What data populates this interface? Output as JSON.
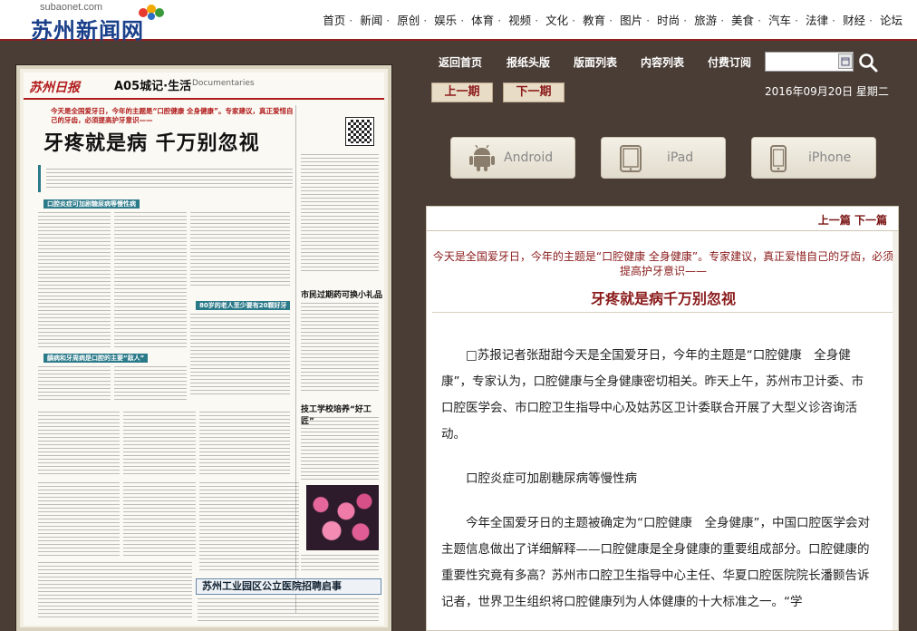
{
  "site": {
    "logo_domain": "subaonet.com",
    "logo_name": "苏州新闻网",
    "nav": [
      "首页",
      "新闻",
      "原创",
      "娱乐",
      "体育",
      "视频",
      "文化",
      "教育",
      "图片",
      "时尚",
      "旅游",
      "美食",
      "汽车",
      "法律",
      "财经",
      "论坛"
    ]
  },
  "epaper": {
    "links": [
      "返回首页",
      "报纸头版",
      "版面列表",
      "内容列表",
      "付费订阅"
    ],
    "prev_page": "上一期",
    "next_page": "下一期",
    "date": "2016年09月20日",
    "weekday": "星期二",
    "apps": [
      "Android",
      "iPad",
      "iPhone"
    ]
  },
  "newspaper_page": {
    "brand": "苏州日报",
    "section": "A05城记·生活",
    "section_en": "Documentaries",
    "lead": "今天是全国爱牙日，今年的主题是“口腔健康 全身健康”。专家建议，真正爱惜自己的牙齿，必须提高护牙意识——",
    "headline": "牙疼就是病 千万别忽视",
    "subheads": [
      "口腔炎症可加剧糖尿病等慢性病",
      "龋病和牙周病是口腔的主要“敌人”",
      "80岁的老人至少要有20颗好牙",
      "市民过期药可换小礼品",
      "技工学校培养“好工匠”"
    ],
    "ad_title": "苏州工业园区公立医院招聘启事"
  },
  "article": {
    "prev": "上一篇",
    "next": "下一篇",
    "lead": "今天是全国爱牙日，今年的主题是“口腔健康 全身健康”。专家建议，真正爱惜自己的牙齿，必须提高护牙意识——",
    "title": "牙疼就是病千万别忽视",
    "paragraphs": [
      "□苏报记者张甜甜今天是全国爱牙日，今年的主题是“口腔健康　全身健康”，专家认为，口腔健康与全身健康密切相关。昨天上午，苏州市卫计委、市口腔医学会、市口腔卫生指导中心及姑苏区卫计委联合开展了大型义诊咨询活动。",
      "口腔炎症可加剧糖尿病等慢性病",
      "今年全国爱牙日的主题被确定为“口腔健康　全身健康”，中国口腔医学会对主题信息做出了详细解释——口腔健康是全身健康的重要组成部分。口腔健康的重要性究竟有多高？苏州市口腔卫生指导中心主任、华夏口腔医院院长潘颢告诉记者，世界卫生组织将口腔健康列为人体健康的十大标准之一。“学"
    ]
  }
}
